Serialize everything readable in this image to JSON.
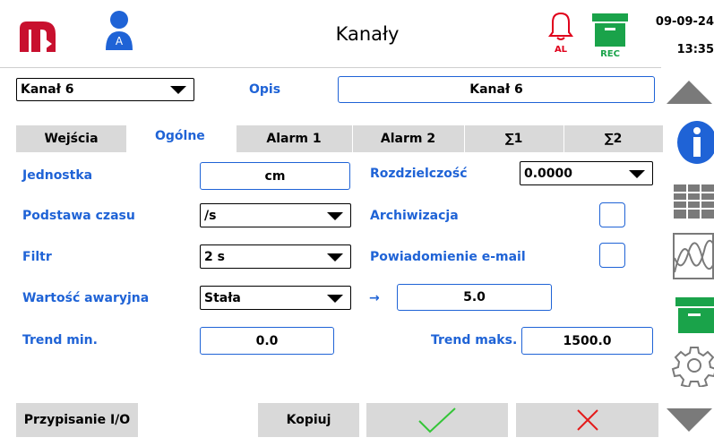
{
  "header": {
    "title": "Kanały",
    "avatar_letter": "A",
    "alarm_label": "AL",
    "rec_label": "REC",
    "date": "09-09-24",
    "time": "13:35"
  },
  "top": {
    "channel_select": "Kanał 6",
    "opis_label": "Opis",
    "opis_value": "Kanał 6"
  },
  "tabs": [
    {
      "label": "Wejścia",
      "active": false
    },
    {
      "label": "Ogólne",
      "active": true
    },
    {
      "label": "Alarm 1",
      "active": false
    },
    {
      "label": "Alarm 2",
      "active": false
    },
    {
      "label": "∑1",
      "active": false
    },
    {
      "label": "∑2",
      "active": false
    }
  ],
  "form": {
    "jednostka_label": "Jednostka",
    "jednostka_value": "cm",
    "rozdzielczosc_label": "Rozdzielczość",
    "rozdzielczosc_value": "0.0000",
    "podstawa_label": "Podstawa czasu",
    "podstawa_value": "/s",
    "archiwizacja_label": "Archiwizacja",
    "filtr_label": "Filtr",
    "filtr_value": "2 s",
    "email_label": "Powiadomienie e-mail",
    "awaryjna_label": "Wartość awaryjna",
    "awaryjna_value": "Stała",
    "arrow": "→",
    "awaryjna_number": "5.0",
    "trend_min_label": "Trend min.",
    "trend_min_value": "0.0",
    "trend_max_label": "Trend maks.",
    "trend_max_value": "1500.0"
  },
  "bottom": {
    "io_button": "Przypisanie I/O",
    "copy_button": "Kopiuj"
  },
  "colors": {
    "accent": "#1f63d6",
    "logo": "#c8102e",
    "alarm": "#e0001b",
    "rec": "#1aa34a",
    "ok": "#34c538",
    "cancel": "#e31b1b",
    "sidebar_gray": "#7a7a7a"
  }
}
